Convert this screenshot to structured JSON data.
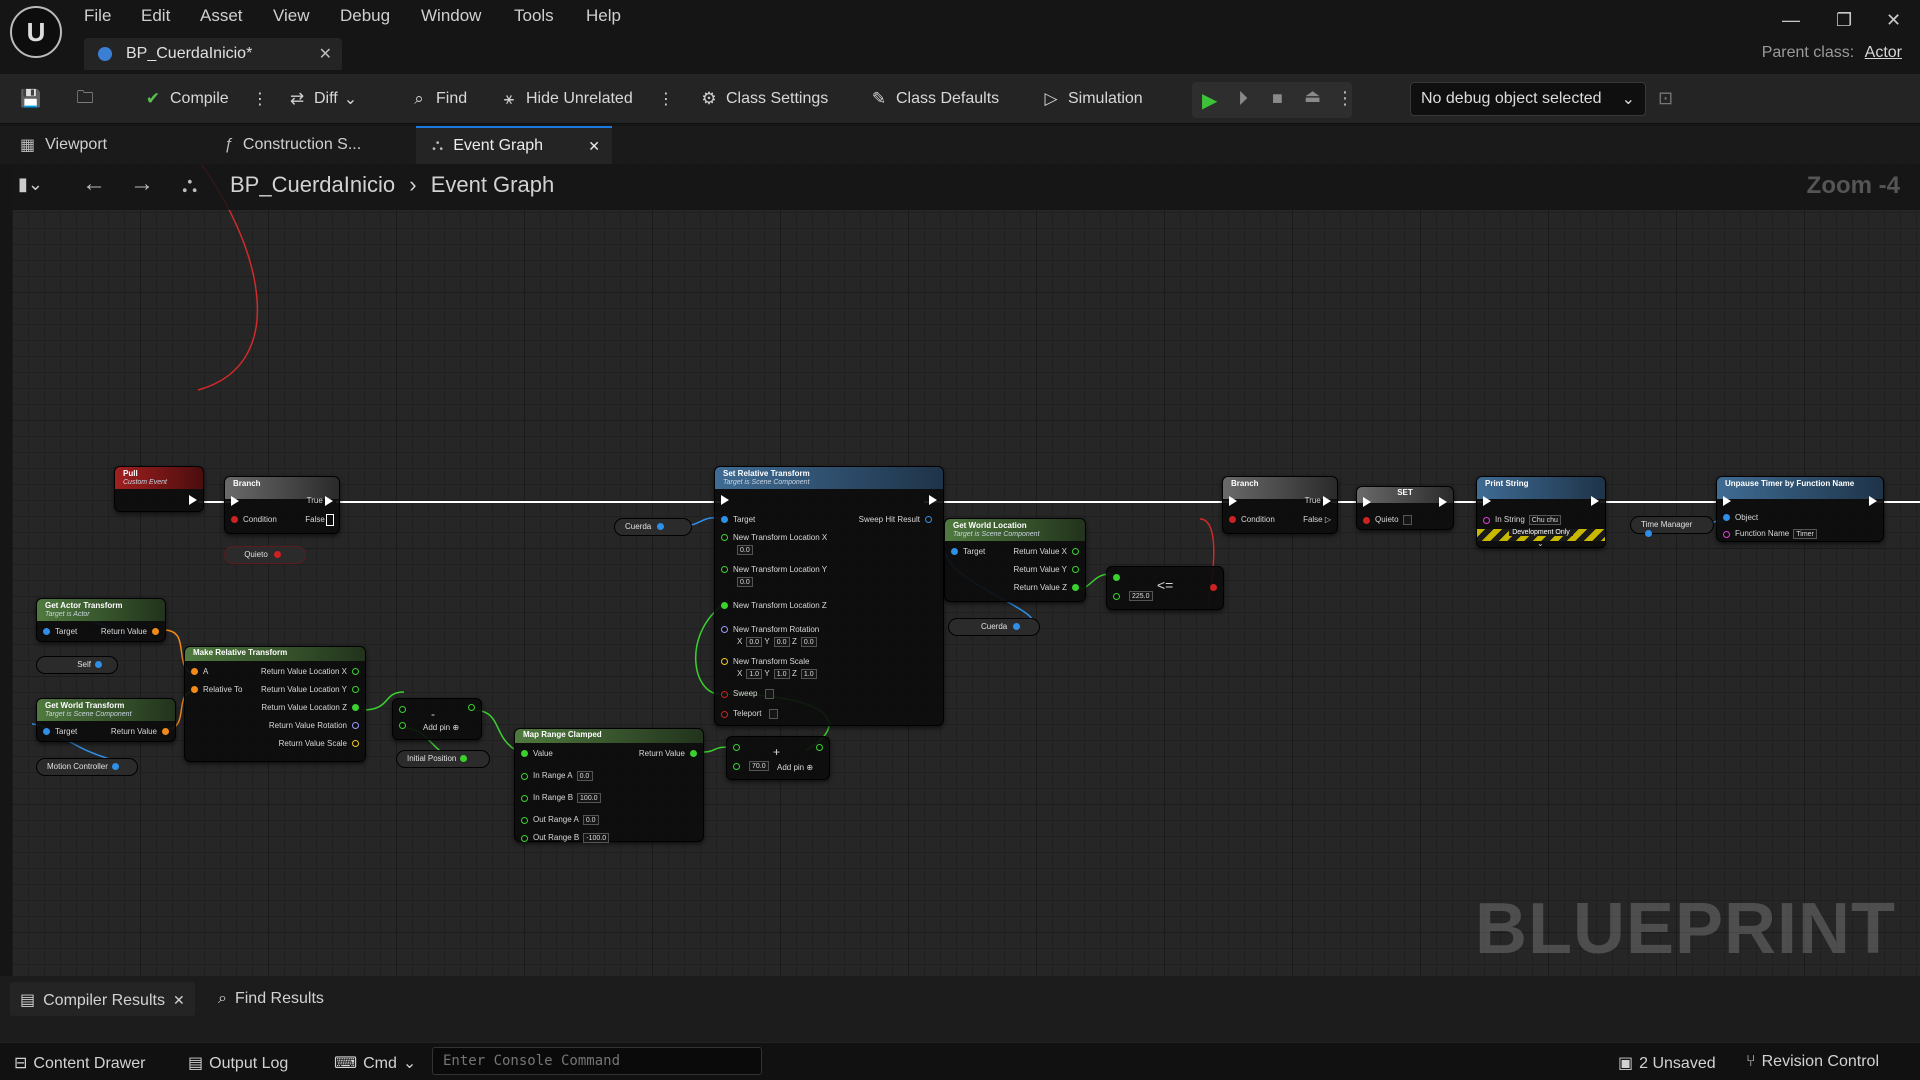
{
  "window": {
    "doc_tab": "BP_CuerdaInicio*",
    "parent_class_label": "Parent class:",
    "parent_class_value": "Actor"
  },
  "menu": [
    "File",
    "Edit",
    "Asset",
    "View",
    "Debug",
    "Window",
    "Tools",
    "Help"
  ],
  "toolbar": {
    "compile": "Compile",
    "diff": "Diff",
    "find": "Find",
    "hide_unrelated": "Hide Unrelated",
    "class_settings": "Class Settings",
    "class_defaults": "Class Defaults",
    "simulation": "Simulation",
    "debug_object": "No debug object selected"
  },
  "panel_tabs": [
    "Viewport",
    "Construction S...",
    "Event Graph"
  ],
  "graph": {
    "breadcrumb_root": "BP_CuerdaInicio",
    "breadcrumb_leaf": "Event Graph",
    "zoom": "Zoom -4",
    "watermark": "BLUEPRINT"
  },
  "nodes": {
    "pull": {
      "title": "Pull",
      "sub": "Custom Event"
    },
    "branch1": {
      "title": "Branch",
      "true": "True",
      "false": "False",
      "condition": "Condition"
    },
    "quieto1": "Quieto",
    "set_rel": {
      "title": "Set Relative Transform",
      "sub": "Target is Scene Component",
      "target": "Target",
      "sweep_hit": "Sweep Hit Result",
      "ntlx": "New Transform Location X",
      "ntlx_v": "0.0",
      "ntly": "New Transform Location Y",
      "ntly_v": "0.0",
      "ntlz": "New Transform Location Z",
      "ntr": "New Transform Rotation",
      "nts": "New Transform Scale",
      "rot_x": "0.0",
      "rot_y": "0.0",
      "rot_z": "0.0",
      "scale_x": "1.0",
      "scale_y": "1.0",
      "scale_z": "1.0",
      "sweep": "Sweep",
      "teleport": "Teleport",
      "axis_x": "X",
      "axis_y": "Y",
      "axis_z": "Z"
    },
    "cuerda1": "Cuerda",
    "get_world_loc": {
      "title": "Get World Location",
      "sub": "Target is Scene Component",
      "target": "Target",
      "rx": "Return Value X",
      "ry": "Return Value Y",
      "rz": "Return Value Z"
    },
    "cuerda2": "Cuerda",
    "lte": {
      "op": "<=",
      "value": "225.0"
    },
    "branch2": {
      "title": "Branch",
      "true": "True",
      "false": "False",
      "condition": "Condition"
    },
    "set": {
      "title": "SET",
      "quieto": "Quieto"
    },
    "print": {
      "title": "Print String",
      "in_string": "In String",
      "value": "Chu chu",
      "dev": "Development Only"
    },
    "time_manager": "Time Manager",
    "unpause": {
      "title": "Unpause Timer by Function Name",
      "object": "Object",
      "fn": "Function Name",
      "fn_value": "Timer"
    },
    "get_actor_tf": {
      "title": "Get Actor Transform",
      "sub": "Target is Actor",
      "target": "Target",
      "rv": "Return Value"
    },
    "self": "Self",
    "get_world_tf": {
      "title": "Get World Transform",
      "sub": "Target is Scene Component",
      "target": "Target",
      "rv": "Return Value"
    },
    "motion": "Motion Controller",
    "make_rel": {
      "title": "Make Relative Transform",
      "a": "A",
      "rel": "Relative To",
      "rvlx": "Return Value Location X",
      "rvly": "Return Value Location Y",
      "rvlz": "Return Value Location Z",
      "rvr": "Return Value Rotation",
      "rvs": "Return Value Scale"
    },
    "sub_node": {
      "op": "-",
      "add": "Add pin"
    },
    "initial_pos": "Initial Position",
    "map_range": {
      "title": "Map Range Clamped",
      "value": "Value",
      "rv": "Return Value",
      "ira": "In Range A",
      "ira_v": "0.0",
      "irb": "In Range B",
      "irb_v": "100.0",
      "ora": "Out Range A",
      "ora_v": "0.0",
      "orb": "Out Range B",
      "orb_v": "-100.0"
    },
    "add_node": {
      "op": "+",
      "value": "70.0",
      "add": "Add pin"
    }
  },
  "bottom": {
    "compiler_results": "Compiler Results",
    "find_results": "Find Results",
    "content_drawer": "Content Drawer",
    "output_log": "Output Log",
    "cmd": "Cmd",
    "console_placeholder": "Enter Console Command",
    "unsaved": "2 Unsaved",
    "revision": "Revision Control"
  },
  "colors": {
    "exec": "#ffffff",
    "bool": "#cc2222",
    "object": "#2f8fe6",
    "float": "#3ad12f",
    "transform": "#f28a1a",
    "accent": "#1c7be0"
  }
}
